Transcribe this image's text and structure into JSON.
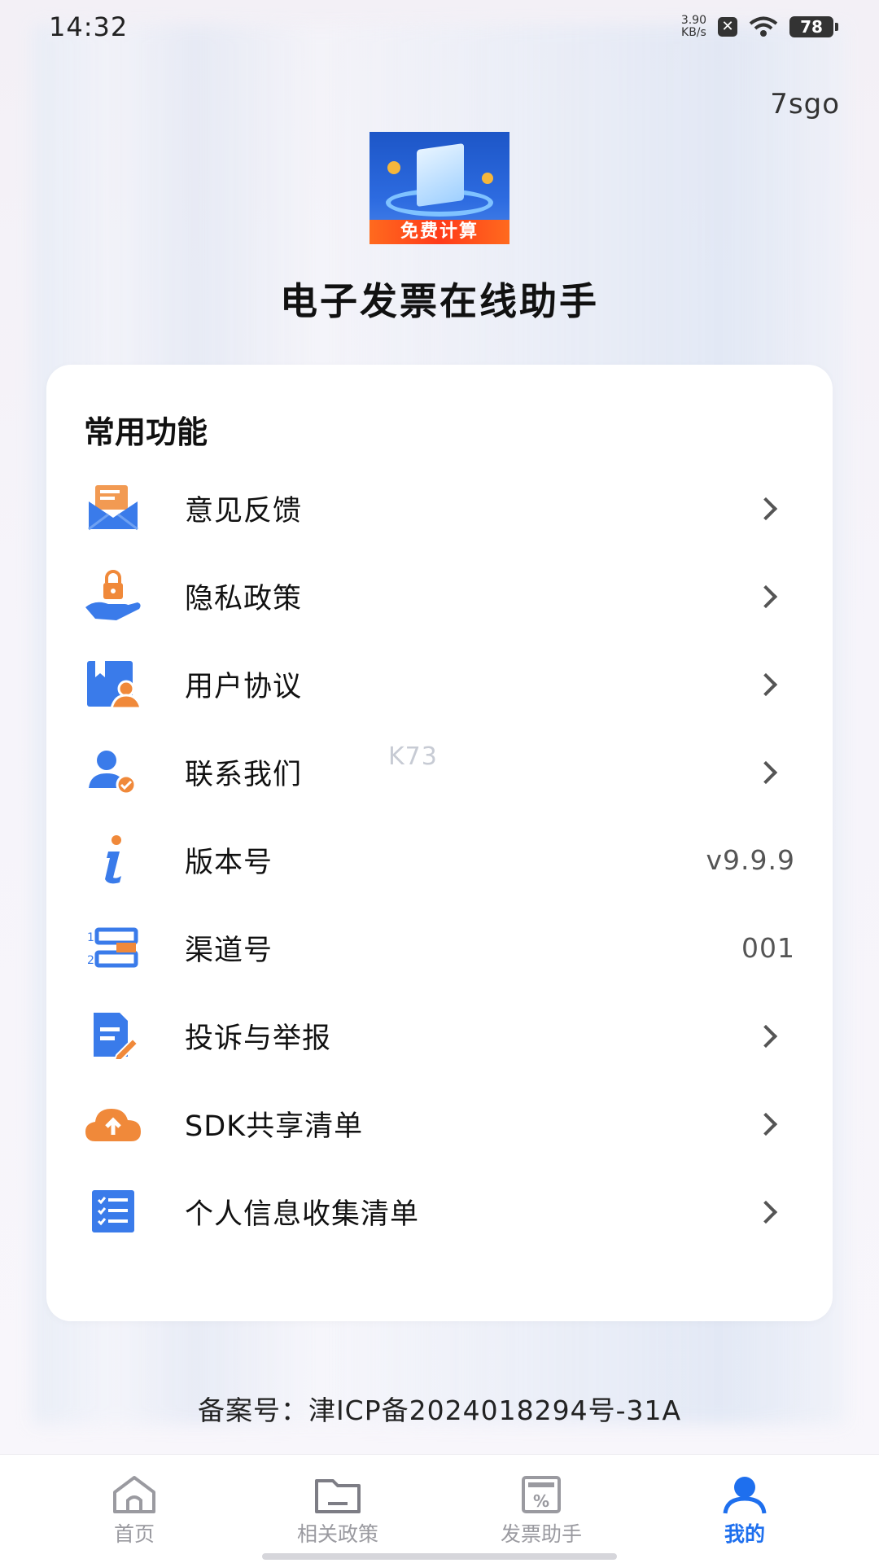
{
  "status_bar": {
    "time": "14:32",
    "net_speed_value": "3.90",
    "net_speed_unit": "KB/s",
    "battery": "78",
    "icons": [
      "close-box-icon",
      "wifi-icon",
      "battery-icon"
    ]
  },
  "watermark_top": "7sgo",
  "watermark_center": "K73",
  "logo": {
    "banner_text": "免费计算"
  },
  "app_title": "电子发票在线助手",
  "card": {
    "title": "常用功能",
    "items": [
      {
        "label": "意见反馈",
        "icon": "envelope-icon",
        "chevron": true
      },
      {
        "label": "隐私政策",
        "icon": "hand-lock-icon",
        "chevron": true
      },
      {
        "label": "用户协议",
        "icon": "user-agreement-icon",
        "chevron": true
      },
      {
        "label": "联系我们",
        "icon": "contact-user-icon",
        "chevron": true
      },
      {
        "label": "版本号",
        "icon": "info-icon",
        "value": "v9.9.9",
        "chevron": false
      },
      {
        "label": "渠道号",
        "icon": "numbered-list-icon",
        "value": "001",
        "chevron": false
      },
      {
        "label": "投诉与举报",
        "icon": "report-edit-icon",
        "chevron": true
      },
      {
        "label": "SDK共享清单",
        "icon": "cloud-upload-icon",
        "chevron": true
      },
      {
        "label": "个人信息收集清单",
        "icon": "checklist-icon",
        "chevron": true
      }
    ]
  },
  "footer": {
    "record_number": "备案号：津ICP备2024018294号-31A"
  },
  "tabbar": {
    "tabs": [
      {
        "label": "首页",
        "icon": "home-icon",
        "active": false
      },
      {
        "label": "相关政策",
        "icon": "folder-icon",
        "active": false
      },
      {
        "label": "发票助手",
        "icon": "invoice-percent-icon",
        "active": false
      },
      {
        "label": "我的",
        "icon": "profile-icon",
        "active": true
      }
    ]
  },
  "colors": {
    "accent": "#1e6fee",
    "icon_blue": "#3a7bea",
    "icon_orange": "#f08a3c"
  }
}
